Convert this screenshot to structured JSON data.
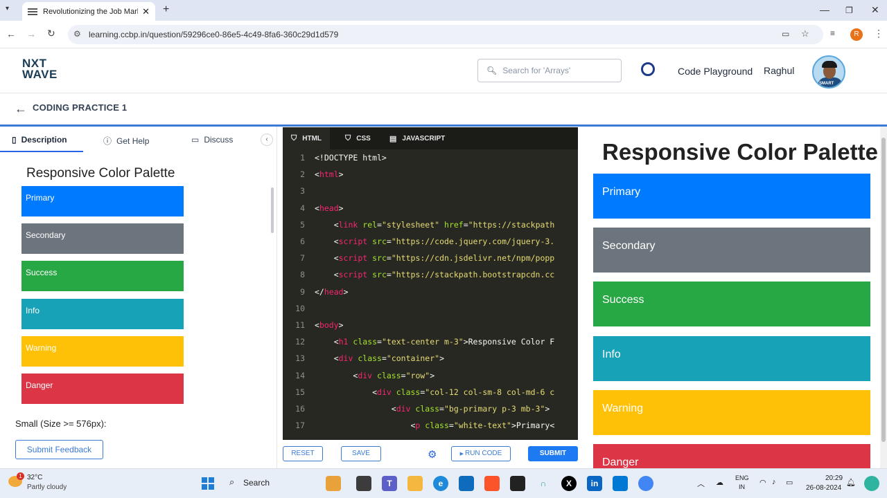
{
  "browser": {
    "tab_title": "Revolutionizing the Job Market",
    "url": "learning.ccbp.in/question/59296ce0-86e5-4c49-8fa6-360c29d1d579",
    "profile_initial": "R"
  },
  "site": {
    "logo_line1": "NXT",
    "logo_line2": "WAVE",
    "search_placeholder": "Search for 'Arrays'",
    "code_playground": "Code Playground",
    "username": "Raghul",
    "avatar_tag": "SMART"
  },
  "practice": {
    "title": "CODING PRACTICE 1"
  },
  "left_panel": {
    "tabs": [
      {
        "label": "Description",
        "icon": "document-icon"
      },
      {
        "label": "Get Help",
        "icon": "help-circle-icon"
      },
      {
        "label": "Discuss",
        "icon": "chat-icon"
      }
    ],
    "mini_heading": "Responsive Color Palette",
    "swatches": [
      "Primary",
      "Secondary",
      "Success",
      "Info",
      "Warning",
      "Danger"
    ],
    "small_size_text": "Small (Size >= 576px):",
    "feedback_label": "Submit Feedback"
  },
  "editor": {
    "tabs": [
      "HTML",
      "CSS",
      "JAVASCRIPT"
    ],
    "lines": [
      {
        "n": "1",
        "parts": [
          [
            "",
            "<!DOCTYPE html>"
          ]
        ]
      },
      {
        "n": "2",
        "parts": [
          [
            "",
            "<"
          ],
          [
            "t",
            "html"
          ],
          [
            "",
            ">"
          ]
        ]
      },
      {
        "n": "3",
        "parts": []
      },
      {
        "n": "4",
        "parts": [
          [
            "",
            "<"
          ],
          [
            "t",
            "head"
          ],
          [
            "",
            ">"
          ]
        ]
      },
      {
        "n": "5",
        "parts": [
          [
            "",
            "    <"
          ],
          [
            "t",
            "link"
          ],
          [
            "",
            " "
          ],
          [
            "a",
            "rel"
          ],
          [
            "",
            "="
          ],
          [
            "s",
            "\"stylesheet\""
          ],
          [
            "",
            " "
          ],
          [
            "a",
            "href"
          ],
          [
            "",
            "="
          ],
          [
            "s",
            "\"https://stackpath"
          ]
        ]
      },
      {
        "n": "6",
        "parts": [
          [
            "",
            "    <"
          ],
          [
            "t",
            "script"
          ],
          [
            "",
            " "
          ],
          [
            "a",
            "src"
          ],
          [
            "",
            "="
          ],
          [
            "s",
            "\"https://code.jquery.com/jquery-3."
          ]
        ]
      },
      {
        "n": "7",
        "parts": [
          [
            "",
            "    <"
          ],
          [
            "t",
            "script"
          ],
          [
            "",
            " "
          ],
          [
            "a",
            "src"
          ],
          [
            "",
            "="
          ],
          [
            "s",
            "\"https://cdn.jsdelivr.net/npm/popp"
          ]
        ]
      },
      {
        "n": "8",
        "parts": [
          [
            "",
            "    <"
          ],
          [
            "t",
            "script"
          ],
          [
            "",
            " "
          ],
          [
            "a",
            "src"
          ],
          [
            "",
            "="
          ],
          [
            "s",
            "\"https://stackpath.bootstrapcdn.cc"
          ]
        ]
      },
      {
        "n": "9",
        "parts": [
          [
            "",
            "</"
          ],
          [
            "t",
            "head"
          ],
          [
            "",
            ">"
          ]
        ]
      },
      {
        "n": "10",
        "parts": []
      },
      {
        "n": "11",
        "parts": [
          [
            "",
            "<"
          ],
          [
            "t",
            "body"
          ],
          [
            "",
            ">"
          ]
        ]
      },
      {
        "n": "12",
        "parts": [
          [
            "",
            "    <"
          ],
          [
            "t",
            "h1"
          ],
          [
            "",
            " "
          ],
          [
            "a",
            "class"
          ],
          [
            "",
            "="
          ],
          [
            "s",
            "\"text-center m-3\""
          ],
          [
            "",
            ">Responsive Color F"
          ]
        ]
      },
      {
        "n": "13",
        "parts": [
          [
            "",
            "    <"
          ],
          [
            "t",
            "div"
          ],
          [
            "",
            " "
          ],
          [
            "a",
            "class"
          ],
          [
            "",
            "="
          ],
          [
            "s",
            "\"container\""
          ],
          [
            "",
            ">"
          ]
        ]
      },
      {
        "n": "14",
        "parts": [
          [
            "",
            "        <"
          ],
          [
            "t",
            "div"
          ],
          [
            "",
            " "
          ],
          [
            "a",
            "class"
          ],
          [
            "",
            "="
          ],
          [
            "s",
            "\"row\""
          ],
          [
            "",
            ">"
          ]
        ]
      },
      {
        "n": "15",
        "parts": [
          [
            "",
            "            <"
          ],
          [
            "t",
            "div"
          ],
          [
            "",
            " "
          ],
          [
            "a",
            "class"
          ],
          [
            "",
            "="
          ],
          [
            "s",
            "\"col-12 col-sm-8 col-md-6 c"
          ]
        ]
      },
      {
        "n": "16",
        "parts": [
          [
            "",
            "                <"
          ],
          [
            "t",
            "div"
          ],
          [
            "",
            " "
          ],
          [
            "a",
            "class"
          ],
          [
            "",
            "="
          ],
          [
            "s",
            "\"bg-primary p-3 mb-3\""
          ],
          [
            "",
            ">"
          ]
        ]
      },
      {
        "n": "17",
        "parts": [
          [
            "",
            "                    <"
          ],
          [
            "t",
            "p"
          ],
          [
            "",
            " "
          ],
          [
            "a",
            "class"
          ],
          [
            "",
            "="
          ],
          [
            "s",
            "\"white-text\""
          ],
          [
            "",
            ">Primary<"
          ]
        ]
      }
    ],
    "buttons": {
      "reset": "RESET",
      "save": "SAVE",
      "run": "RUN CODE",
      "submit": "SUBMIT"
    }
  },
  "preview": {
    "heading": "Responsive Color Palette",
    "swatches": [
      "Primary",
      "Secondary",
      "Success",
      "Info",
      "Warning",
      "Danger"
    ]
  },
  "colors": {
    "primary": "#007bff",
    "secondary": "#6c757d",
    "success": "#28a745",
    "info": "#17a2b8",
    "warning": "#ffc107",
    "danger": "#dc3545"
  },
  "taskbar": {
    "temperature": "32°C",
    "condition": "Partly cloudy",
    "weather_badge": "1",
    "search_label": "Search",
    "lang1": "ENG",
    "lang2": "IN",
    "time": "20:29",
    "date": "26-08-2024"
  }
}
